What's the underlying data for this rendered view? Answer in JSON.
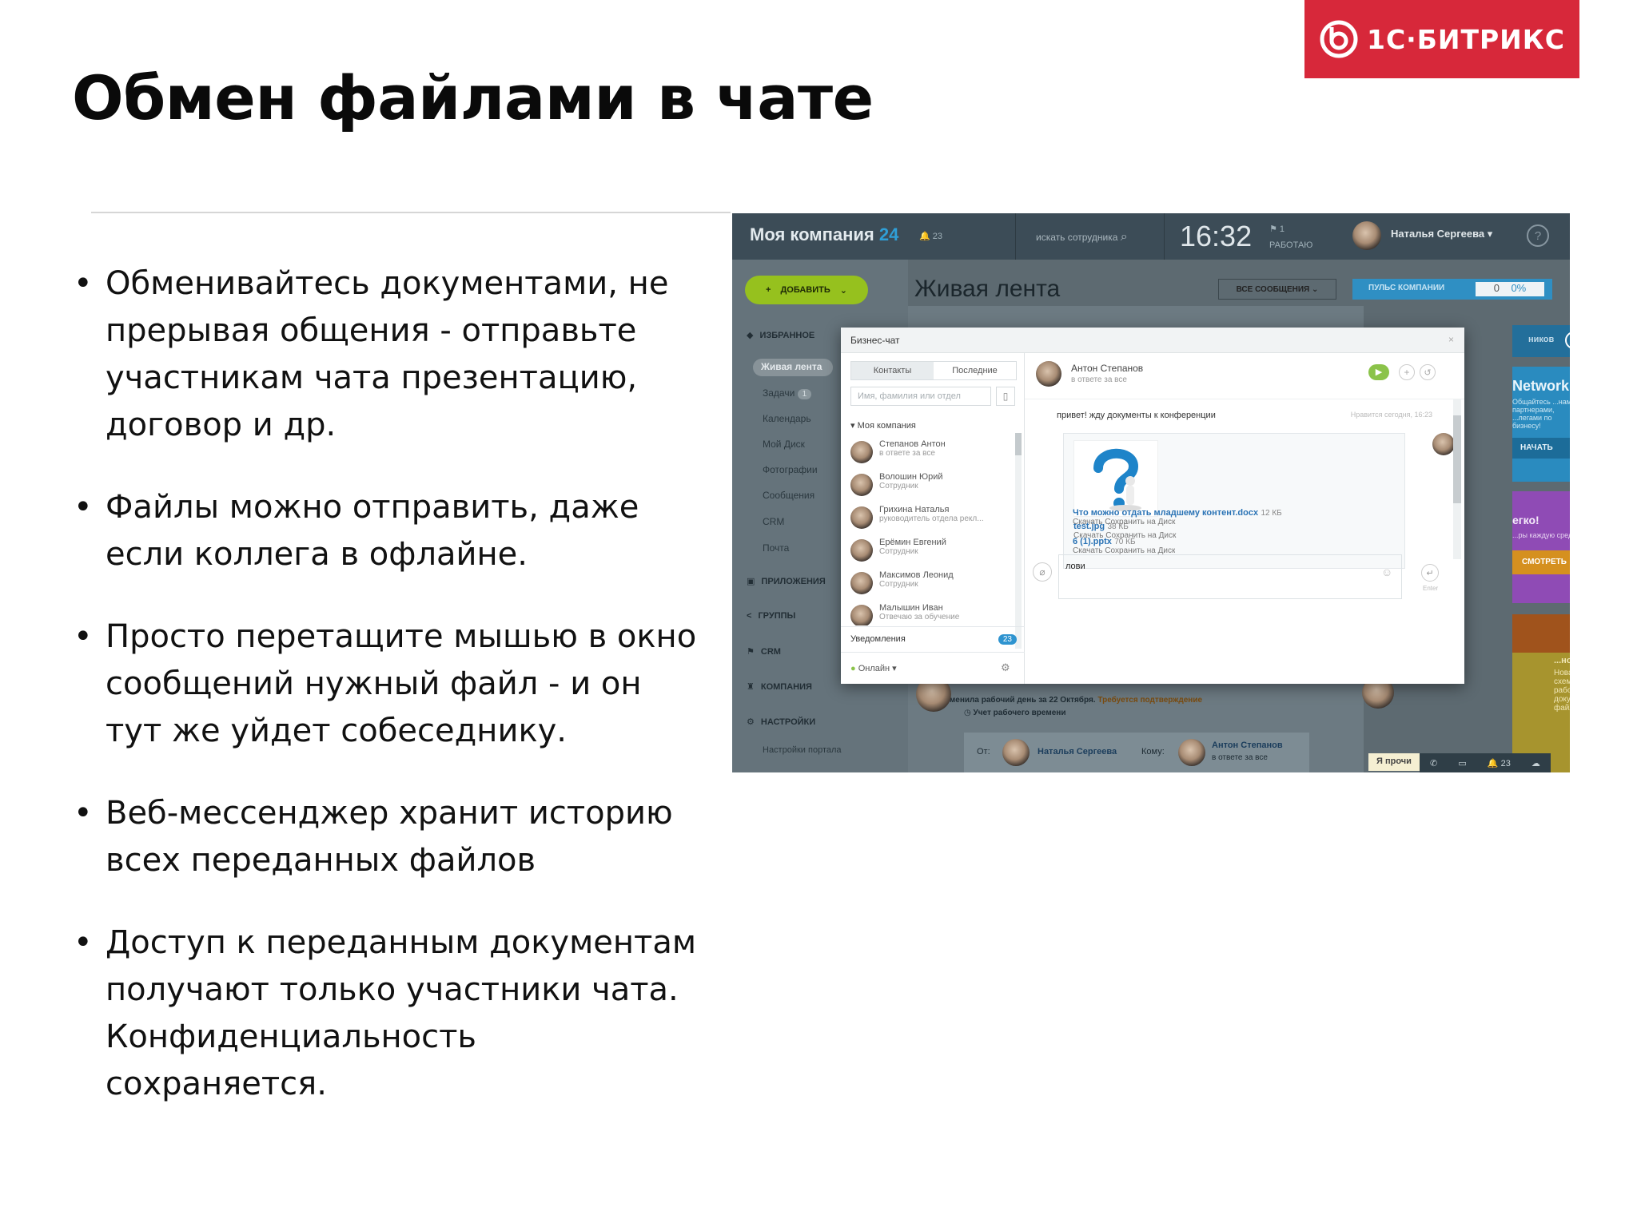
{
  "brand": {
    "logo_text": "1С·БИТРИКС",
    "color": "#d7283a"
  },
  "slide": {
    "title": "Обмен файлами в чате",
    "bullets": [
      "Обменивайтесь документами, не прерывая общения - отправьте участникам чата презентацию, договор и др.",
      "Файлы можно отправить, даже если коллега в офлайне.",
      "Просто перетащите мышью в окно сообщений нужный файл - и он тут же уйдет собеседнику.",
      "Веб-мессенджер хранит историю всех переданных файлов",
      "Доступ к переданным документам получают только участники чата. Конфиденциальность сохраняется."
    ]
  },
  "app": {
    "topbar": {
      "company": "Моя компания",
      "company_count": "24",
      "notif_count": "23",
      "search_placeholder": "искать сотрудника",
      "time": "16:32",
      "work_flag": "1",
      "work_status": "РАБОТАЮ",
      "user_name": "Наталья Сергеева",
      "help": "?"
    },
    "leftnav": {
      "add_button": "ДОБАВИТЬ",
      "favorites": "ИЗБРАННОЕ",
      "active_item": "Живая лента",
      "items": [
        "Задачи",
        "Календарь",
        "Мой Диск",
        "Фотографии",
        "Сообщения",
        "CRM",
        "Почта"
      ],
      "tasks_count": "1",
      "sections": [
        "ПРИЛОЖЕНИЯ",
        "ГРУППЫ",
        "CRM",
        "КОМПАНИЯ",
        "НАСТРОЙКИ"
      ],
      "portal_settings": "Настройки портала"
    },
    "feed": {
      "title": "Живая лента",
      "filter": "ВСЕ СООБЩЕНИЯ",
      "pulse_label": "ПУЛЬС КОМПАНИИ",
      "pulse_value": "0",
      "pulse_percent": "0%",
      "card_text": "Изменила рабочий день за 22 Октября.",
      "card_link": "Требуется подтверждение",
      "card_sub": "Учет рабочего времени",
      "from_label": "От:",
      "from_name": "Наталья Сергеева",
      "to_label": "Кому:",
      "to_name": "Антон Степанов",
      "to_status": "в ответе за все"
    },
    "right_cards": {
      "card1_label": "ников",
      "network_title": "Network",
      "network_text": "Общайтесь ...нами, партнерами, ...легами по бизнесу!",
      "network_btn": "НАЧАТЬ",
      "card3_title": "егко!",
      "card3_text": "...ры каждую среду",
      "card3_btn": "СМОТРЕТЬ",
      "card4_name": "...нов",
      "card4_text": "Новая схема работы с документами файл",
      "card4_btn": "Я прочи",
      "bottom_count": "23"
    },
    "chat": {
      "title": "Бизнес-чат",
      "tabs": [
        "Контакты",
        "Последние"
      ],
      "search_placeholder": "Имя, фамилия или отдел",
      "group": "Моя компания",
      "contacts": [
        {
          "name": "Степанов Антон",
          "status": "в ответе за все"
        },
        {
          "name": "Волошин Юрий",
          "status": "Сотрудник"
        },
        {
          "name": "Грихина Наталья",
          "status": "руководитель отдела рекл..."
        },
        {
          "name": "Ерёмин Евгений",
          "status": "Сотрудник"
        },
        {
          "name": "Максимов Леонид",
          "status": "Сотрудник"
        },
        {
          "name": "Малышин Иван",
          "status": "Отвечаю за обучение"
        }
      ],
      "notifications_label": "Уведомления",
      "notifications_count": "23",
      "status": "Онлайн",
      "interlocutor_name": "Антон Степанов",
      "interlocutor_status": "в ответе за все",
      "message_text": "привет! жду документы к конференции",
      "message_meta": "Нравится   сегодня, 16:23",
      "files": [
        {
          "name": "test.jpg",
          "size": "38 КБ",
          "actions": "Скачать   Сохранить на Диск"
        },
        {
          "name": "Что можно отдать младшему контент.docx",
          "size": "12 КБ",
          "actions": "Скачать   Сохранить на Диск"
        },
        {
          "name": "6 (1).pptx",
          "size": "70 КБ",
          "actions": "Скачать   Сохранить на Диск"
        }
      ],
      "compose_text": "лови",
      "enter_hint": "Enter"
    }
  }
}
